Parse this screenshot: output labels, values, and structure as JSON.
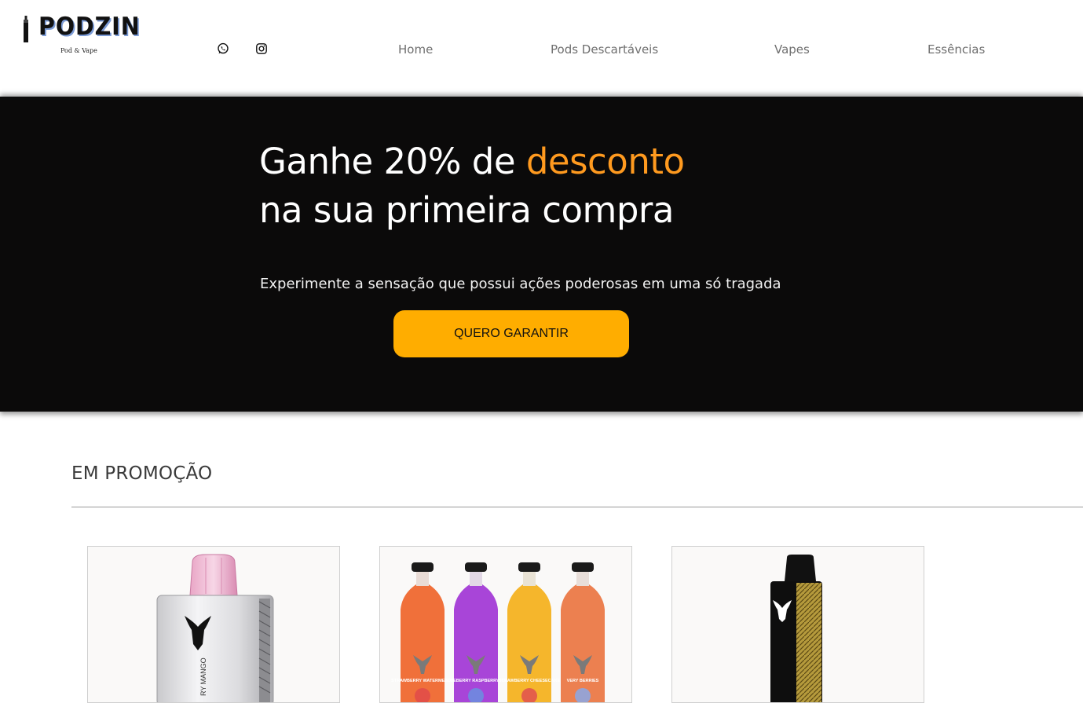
{
  "header": {
    "logo": {
      "name": "PODZIN",
      "tagline": "Pod & Vape"
    },
    "social": [
      {
        "icon": "whatsapp-icon"
      },
      {
        "icon": "instagram-icon"
      }
    ],
    "nav": [
      "Home",
      "Pods Descartáveis",
      "Vapes",
      "Essências"
    ]
  },
  "hero": {
    "title_part1": "Ganhe 20% de ",
    "title_accent": "desconto",
    "title_line2": "na sua primeira compra",
    "subtitle": "Experimente a sensação que possui ações poderosas em uma só tragada",
    "button_label": "QUERO GARANTIR",
    "colors": {
      "background": "#0b0a0a",
      "accent": "#ff9a1f",
      "button": "#ffad00"
    }
  },
  "promo": {
    "title": "EM PROMOÇÃO",
    "products": [
      {
        "image": "silver-pod-device",
        "label_text": "RY MANGO"
      },
      {
        "image": "four-colored-pod-bottles",
        "flavors": [
          "STRAWBERRY WATERMELON",
          "BLUEBERRY RASPBERRY ICE",
          "STRAWBERRY CHEESECAKE",
          "VERY BERRIES"
        ]
      },
      {
        "image": "black-gold-vape-pen"
      }
    ]
  }
}
